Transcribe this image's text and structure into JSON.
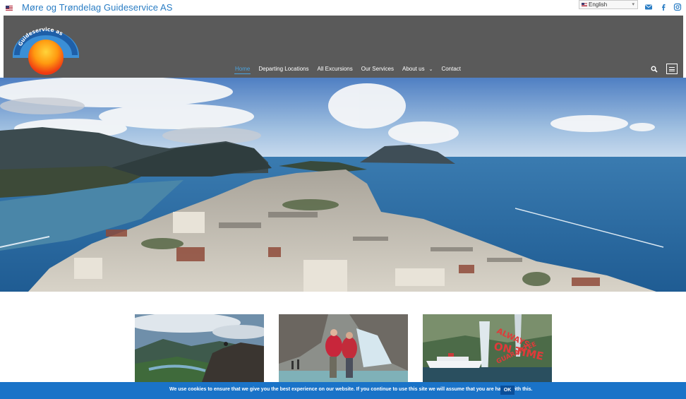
{
  "header": {
    "site_title": "Møre og Trøndelag Guideservice AS",
    "language": "English",
    "icons": [
      "envelope-icon",
      "facebook-icon",
      "instagram-icon"
    ]
  },
  "logo": {
    "text": "Guideservice as"
  },
  "nav": {
    "items": [
      {
        "label": "Home",
        "active": true
      },
      {
        "label": "Departing Locations",
        "active": false
      },
      {
        "label": "All Excursions",
        "active": false
      },
      {
        "label": "Our Services",
        "active": false
      },
      {
        "label": "About us",
        "active": false,
        "dropdown": true
      },
      {
        "label": "Contact",
        "active": false
      }
    ]
  },
  "cards": [
    {
      "image": "mountain-viewpoint-photo"
    },
    {
      "image": "couple-at-glacier-photo"
    },
    {
      "image": "cruise-ship-waterfall-photo",
      "overlay_lines": [
        "ALWAYS",
        "ON TIME",
        "GUARANTEE"
      ]
    }
  ],
  "cookie": {
    "text": "We use cookies to ensure that we give you the best experience on our website. If you continue to use this site we will assume that you are happy with this.",
    "ok_label": "OK"
  },
  "colors": {
    "navbar": "#5a5a5a",
    "title_blue": "#2a7dc4",
    "active_nav": "#4aa3df",
    "cookie_bar": "#1a73c8"
  }
}
